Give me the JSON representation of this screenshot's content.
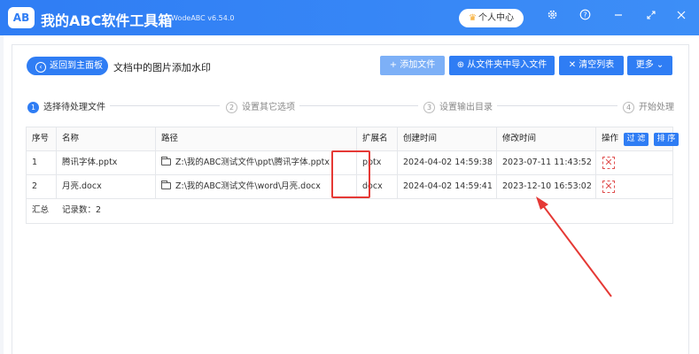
{
  "app": {
    "logo": "AB",
    "title": "我的ABC软件工具箱",
    "version": "WodeABC v6.54.0",
    "vip_label": "个人中心",
    "icons": [
      "gear-icon",
      "help-icon",
      "minimize-icon",
      "restore-icon",
      "close-icon"
    ]
  },
  "toolbar": {
    "back_label": "返回到主面板",
    "page_title": "文档中的图片添加水印",
    "add_file": "+ 添加文件",
    "import_folder": "⊕ 从文件夹中导入文件",
    "clear_list": "✕ 清空列表",
    "more": "更多 ⌄"
  },
  "steps": [
    {
      "num": "1",
      "label": "选择待处理文件"
    },
    {
      "num": "2",
      "label": "设置其它选项"
    },
    {
      "num": "3",
      "label": "设置输出目录"
    },
    {
      "num": "4",
      "label": "开始处理"
    }
  ],
  "table": {
    "headers": [
      "序号",
      "名称",
      "路径",
      "扩展名",
      "创建时间",
      "修改时间",
      "操作"
    ],
    "filter_label": "过 滤",
    "sort_label": "排 序",
    "rows": [
      {
        "index": "1",
        "name": "腾讯字体.pptx",
        "path": "Z:\\我的ABC测试文件\\ppt\\腾讯字体.pptx",
        "ext": "pptx",
        "created": "2024-04-02 14:59:38",
        "modified": "2023-07-11 11:43:52"
      },
      {
        "index": "2",
        "name": "月亮.docx",
        "path": "Z:\\我的ABC测试文件\\word\\月亮.docx",
        "ext": "docx",
        "created": "2024-04-02 14:59:41",
        "modified": "2023-12-10 16:53:02"
      }
    ],
    "summary_label": "汇总",
    "summary_count": "记录数：2"
  },
  "colors": {
    "primary": "#2f7df4",
    "primary_light": "#7db0f7",
    "highlight": "#e53935"
  }
}
